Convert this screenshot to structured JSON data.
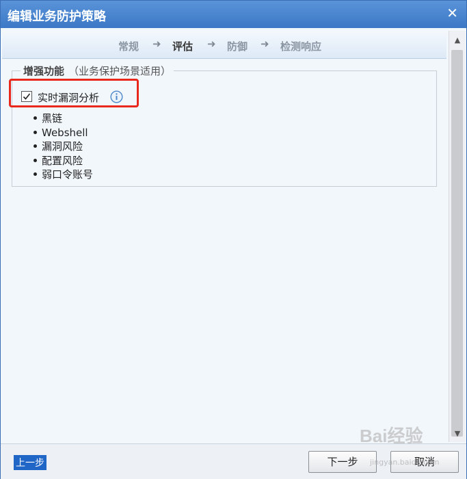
{
  "window": {
    "title": "编辑业务防护策略",
    "close_glyph": "✕"
  },
  "steps": [
    {
      "label": "常规",
      "active": false
    },
    {
      "label": "评估",
      "active": true
    },
    {
      "label": "防御",
      "active": false
    },
    {
      "label": "检测响应",
      "active": false
    }
  ],
  "step_arrow": "➜",
  "group": {
    "title": "增强功能",
    "subtitle": "（业务保护场景适用）"
  },
  "option": {
    "label": "实时漏洞分析",
    "checked": true,
    "info_icon": "info-icon"
  },
  "features": [
    "黑链",
    "Webshell",
    "漏洞风险",
    "配置风险",
    "弱口令账号"
  ],
  "footer": {
    "prev_label": "上一步",
    "next_label": "下一步",
    "cancel_label": "取消"
  },
  "watermark": {
    "text": "Bai经验",
    "sub": "jingyan.baidu.com"
  },
  "colors": {
    "highlight": "#e8271d",
    "titlebar": "#3b78c6"
  }
}
